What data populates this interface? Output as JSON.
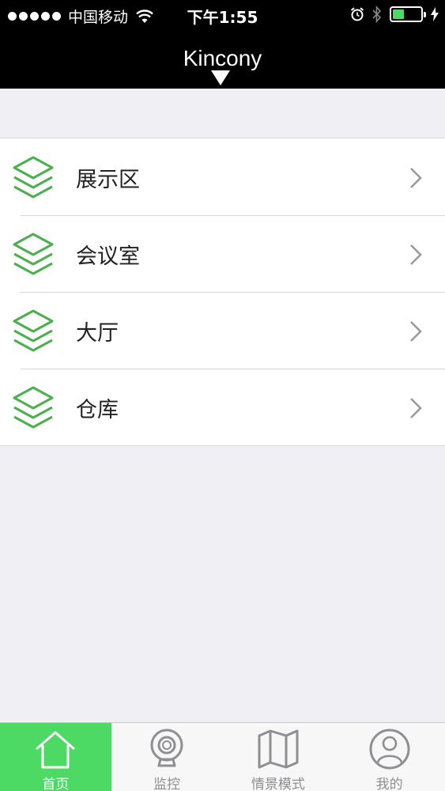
{
  "status_bar": {
    "carrier": "中国移动",
    "time": "下午1:55"
  },
  "nav": {
    "title": "Kincony"
  },
  "list": {
    "items": [
      {
        "label": "展示区",
        "icon": "layers-icon"
      },
      {
        "label": "会议室",
        "icon": "layers-icon"
      },
      {
        "label": "大厅",
        "icon": "layers-icon"
      },
      {
        "label": "仓库",
        "icon": "layers-icon"
      }
    ]
  },
  "tabs": [
    {
      "label": "首页",
      "icon": "home-icon",
      "active": true
    },
    {
      "label": "监控",
      "icon": "camera-icon",
      "active": false
    },
    {
      "label": "情景模式",
      "icon": "map-icon",
      "active": false
    },
    {
      "label": "我的",
      "icon": "user-icon",
      "active": false
    }
  ],
  "colors": {
    "accent": "#4cd964",
    "icon_green": "#4caf50",
    "bar_background": "#000000",
    "page_background": "#efeff4"
  }
}
